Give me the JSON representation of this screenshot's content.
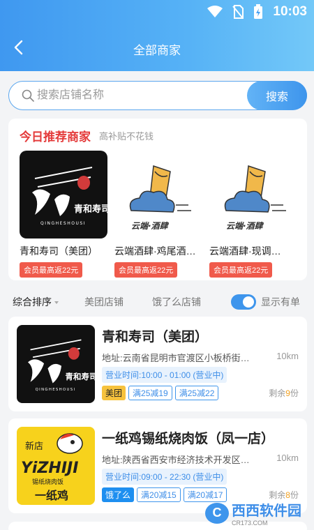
{
  "status_bar": {
    "time": "10:03",
    "icons": [
      "wifi-icon",
      "no-sim-icon",
      "battery-charging-icon"
    ]
  },
  "header": {
    "title": "全部商家",
    "back_icon": "chevron-left-icon"
  },
  "search": {
    "placeholder": "搜索店铺名称",
    "button_label": "搜索"
  },
  "recommend": {
    "title": "今日推荐商家",
    "subtitle": "高补贴不花钱",
    "items": [
      {
        "name": "青和寿司（美团）",
        "badge": "会员最高返22元",
        "logo_text": "青和寿司",
        "logo_sub": "QINGHESHOUSI"
      },
      {
        "name": "云端酒肆·鸡尾酒…",
        "badge": "会员最高返22元",
        "logo_text": "云端·酒肆"
      },
      {
        "name": "云端酒肆·现调…",
        "badge": "会员最高返22元",
        "logo_text": "云端·酒肆"
      }
    ]
  },
  "filter": {
    "sort_label": "综合排序",
    "meituan_label": "美团店铺",
    "eleme_label": "饿了么店铺",
    "toggle_label": "显示有单",
    "toggle_on": true
  },
  "stores": [
    {
      "name": "青和寿司（美团）",
      "address": "地址:云南省昆明市官渡区小板桥街道…",
      "distance": "10km",
      "hours": "营业时间:10:00 - 01:00 (营业中)",
      "platform": "美团",
      "promos": [
        "满25减19",
        "满25减22"
      ],
      "remaining_prefix": "剩余",
      "remaining_num": "9",
      "remaining_suffix": "份",
      "logo_text": "青和寿司",
      "logo_sub": "QINGHESHOUSI"
    },
    {
      "name": "一纸鸡锡纸烧肉饭（凤一店）",
      "address": "地址:陕西省西安市经济技术开发区…",
      "distance": "10km",
      "hours": "营业时间:09:00 - 22:30 (营业中)",
      "platform": "饿了么",
      "promos": [
        "满20减15",
        "满20减17"
      ],
      "remaining_prefix": "剩余",
      "remaining_num": "8",
      "remaining_suffix": "份",
      "logo_badge": "新店",
      "logo_brand": "YiZHIJI",
      "logo_text": "锡纸烧肉饭",
      "logo_bottom": "一纸鸡"
    }
  ],
  "watermark": {
    "text": "西西软件园",
    "sub": "CR173.COM"
  },
  "colors": {
    "accent": "#3e95ec",
    "red": "#e43b3b",
    "badge": "#f05a4b",
    "meituan": "#f6c23d",
    "eleme": "#1e8ff0"
  }
}
